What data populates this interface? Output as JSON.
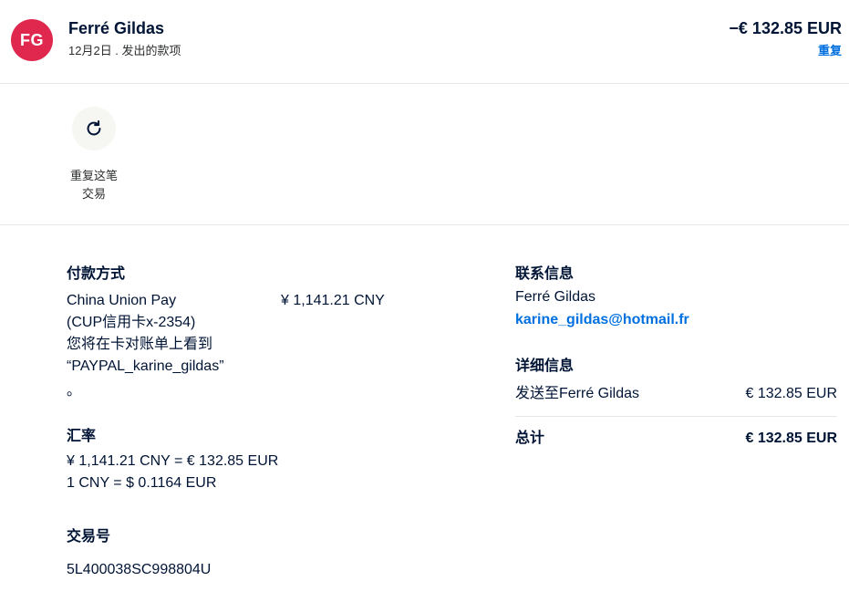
{
  "header": {
    "avatar_initials": "FG",
    "name": "Ferré Gildas",
    "subline": "12月2日 . 发出的款项",
    "amount": "−€ 132.85 EUR",
    "repeat_link": "重复"
  },
  "actions": {
    "repeat_line1": "重复这笔",
    "repeat_line2": "交易"
  },
  "payment": {
    "title": "付款方式",
    "line1": "China Union Pay",
    "line2": "(CUP信用卡x-2354)",
    "line3": "您将在卡对账单上看到",
    "line4": "“PAYPAL_karine_gildas”",
    "line5": "。",
    "amount": "¥ 1,141.21 CNY"
  },
  "exchange": {
    "title": "汇率",
    "line1": "¥ 1,141.21 CNY = € 132.85 EUR",
    "line2": "1 CNY = $ 0.1164 EUR"
  },
  "transaction": {
    "title": "交易号",
    "id": "5L400038SC998804U"
  },
  "contact": {
    "title": "联系信息",
    "name": "Ferré Gildas",
    "email": "karine_gildas@hotmail.fr"
  },
  "details": {
    "title": "详细信息",
    "item_label": "发送至Ferré Gildas",
    "item_amount": "€ 132.85 EUR",
    "total_label": "总计",
    "total_amount": "€ 132.85 EUR"
  },
  "colors": {
    "avatar_bg": "#e0284f",
    "link": "#0070e0",
    "text": "#001435"
  },
  "icons": {
    "repeat": "refresh-icon"
  }
}
